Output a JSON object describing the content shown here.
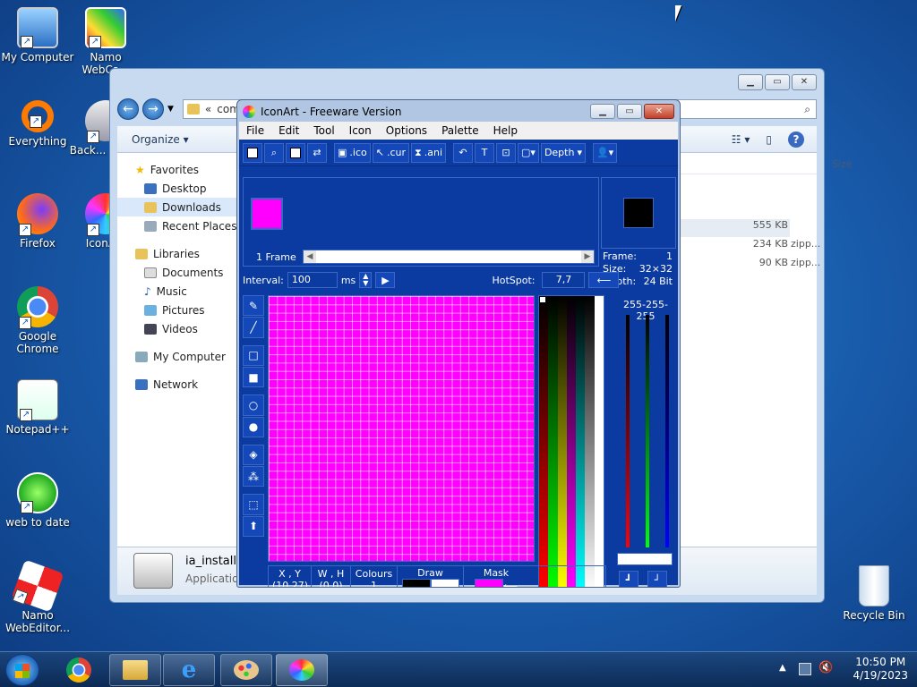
{
  "desktop": {
    "icons": [
      {
        "label": "My Computer"
      },
      {
        "label": "Namo WebCa..."
      },
      {
        "label": "Everything"
      },
      {
        "label": "Back... Mak..."
      },
      {
        "label": "Firefox"
      },
      {
        "label": "IconA..."
      },
      {
        "label": "Google Chrome"
      },
      {
        "label": "Notepad++"
      },
      {
        "label": "web to date"
      },
      {
        "label": "Namo WebEditor..."
      },
      {
        "label": "Recycle Bin"
      }
    ]
  },
  "explorer": {
    "address": "com",
    "organize": "Organize",
    "size_header": "Size",
    "nav": {
      "favorites": "Favorites",
      "desktop": "Desktop",
      "downloads": "Downloads",
      "recent": "Recent Places",
      "libraries": "Libraries",
      "documents": "Documents",
      "music": "Music",
      "pictures": "Pictures",
      "videos": "Videos",
      "computer": "My Computer",
      "network": "Network"
    },
    "files": [
      {
        "type": "",
        "size": "555 KB"
      },
      {
        "type": "zipp...",
        "size": "234 KB"
      },
      {
        "type": "zipp...",
        "size": "90 KB"
      }
    ],
    "details": {
      "name": "ia_install",
      "type": "Application"
    }
  },
  "iconart": {
    "title": "IconArt - Freeware Version",
    "menu": [
      "File",
      "Edit",
      "Tool",
      "Icon",
      "Options",
      "Palette",
      "Help"
    ],
    "toolbar": {
      "ico": ".ico",
      "cur": ".cur",
      "ani": ".ani",
      "depth": "Depth"
    },
    "frame_label": "1 Frame",
    "info": {
      "frame_label": "Frame:",
      "frame": "1",
      "size_label": "Size:",
      "size": "32×32",
      "depth_label": "Depth:",
      "depth": "24 Bit"
    },
    "interval_label": "Interval:",
    "interval": "100",
    "ms": "ms",
    "hotspot_label": "HotSpot:",
    "hotspot": "7,7",
    "rgb": "255-255-255",
    "status": {
      "xy_label": "X , Y",
      "xy": "(10,27)",
      "wh_label": "W , H",
      "wh": "(0,0)",
      "colours_label": "Colours",
      "colours": "1",
      "draw_label": "Draw",
      "mask_label": "Mask"
    }
  },
  "taskbar": {
    "time": "10:50 PM",
    "date": "4/19/2023"
  }
}
